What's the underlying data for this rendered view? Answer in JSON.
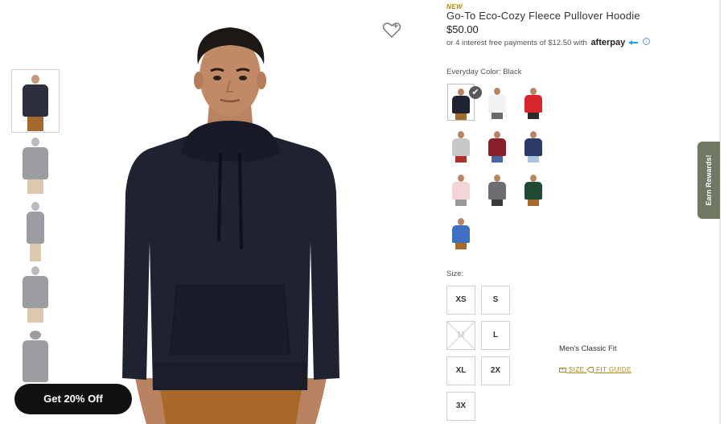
{
  "product": {
    "badge": "NEW",
    "title": "Go-To Eco-Cozy Fleece Pullover Hoodie",
    "price": "$50.00",
    "installments_text": "or 4 interest free payments of $12.50 with",
    "afterpay_logo": "afterpay",
    "info_icon": "i"
  },
  "color": {
    "label": "Everyday Color: Black",
    "selected": "Black",
    "swatches": [
      {
        "color": "#1f2230",
        "legs": "#a5692e"
      },
      {
        "color": "#f2f2f2",
        "legs": "#6b6b6b"
      },
      {
        "color": "#d8262d",
        "legs": "#2b2b2b"
      },
      {
        "color": "#c8c8c8",
        "legs": "#b03030"
      },
      {
        "color": "#8a1f2a",
        "legs": "#4a68a0"
      },
      {
        "color": "#2b3a66",
        "legs": "#a9c4de"
      },
      {
        "color": "#f1d5d7",
        "legs": "#9a9a9a"
      },
      {
        "color": "#6e6e72",
        "legs": "#3a3a3a"
      },
      {
        "color": "#1f4a34",
        "legs": "#a5692e"
      },
      {
        "color": "#3d6fc2",
        "legs": "#a5692e"
      }
    ]
  },
  "size": {
    "label": "Size:",
    "options": [
      "XS",
      "S",
      "M",
      "L",
      "XL",
      "2X",
      "3X"
    ],
    "unavailable": [
      "M"
    ]
  },
  "fit": {
    "label": "Men's Classic Fit",
    "size_link": "SIZE",
    "fit_guide_link": "FIT GUIDE"
  },
  "rewards_tab": "Earn Rewards!",
  "discount_button": "Get 20% Off",
  "colors": {
    "accent_gold": "#b8860b",
    "rewards_bg": "#6f7862",
    "hoodie": "#1f2230"
  }
}
